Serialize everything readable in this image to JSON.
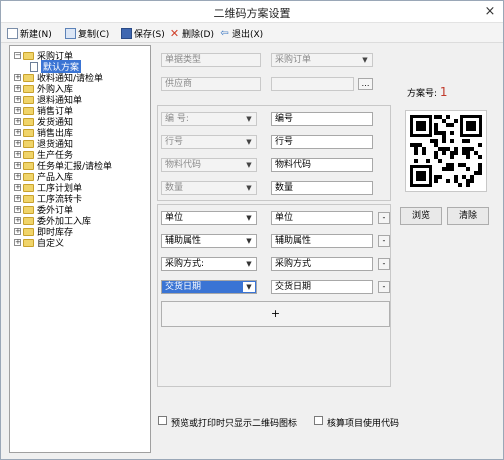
{
  "window": {
    "title": "二维码方案设置",
    "close": "×"
  },
  "toolbar": {
    "new": "新建(N)",
    "copy": "复制(C)",
    "save": "保存(S)",
    "delete": "删除(D)",
    "exit": "退出(X)"
  },
  "tree": {
    "root": "采购订单",
    "selected": "默认方案",
    "items": [
      "收料通知/请检单",
      "外购入库",
      "退料通知单",
      "销售订单",
      "发货通知",
      "销售出库",
      "退货通知",
      "生产任务",
      "任务单汇报/请检单",
      "产品入库",
      "工序计划单",
      "工序流转卡",
      "委外订单",
      "委外加工入库",
      "即时库存",
      "自定义"
    ]
  },
  "top": {
    "bill_type_label": "单据类型",
    "bill_type_value": "采购订单",
    "supplier_label": "供应商",
    "supplier_value": ""
  },
  "plan": {
    "label": "方案号:",
    "value": "1"
  },
  "fixed_fields": [
    {
      "field": "编    号:",
      "value": "编号"
    },
    {
      "field": "行号",
      "value": "行号"
    },
    {
      "field": "物料代码",
      "value": "物料代码"
    },
    {
      "field": "数量",
      "value": "数量"
    }
  ],
  "custom_fields": [
    {
      "field": "单位",
      "value": "单位"
    },
    {
      "field": "辅助属性",
      "value": "辅助属性"
    },
    {
      "field": "采购方式:",
      "value": "采购方式"
    },
    {
      "field": "交货日期",
      "value": "交货日期"
    }
  ],
  "custom_btn": "-",
  "add_btn": "+",
  "buttons": {
    "browse": "浏览",
    "clear": "清除"
  },
  "options": {
    "preview_only_qr": "预览或打印时只显示二维码图标",
    "use_code": "核算项目使用代码"
  },
  "colors": {
    "plan_number": "#c0392b",
    "selection": "#3a74d4"
  }
}
